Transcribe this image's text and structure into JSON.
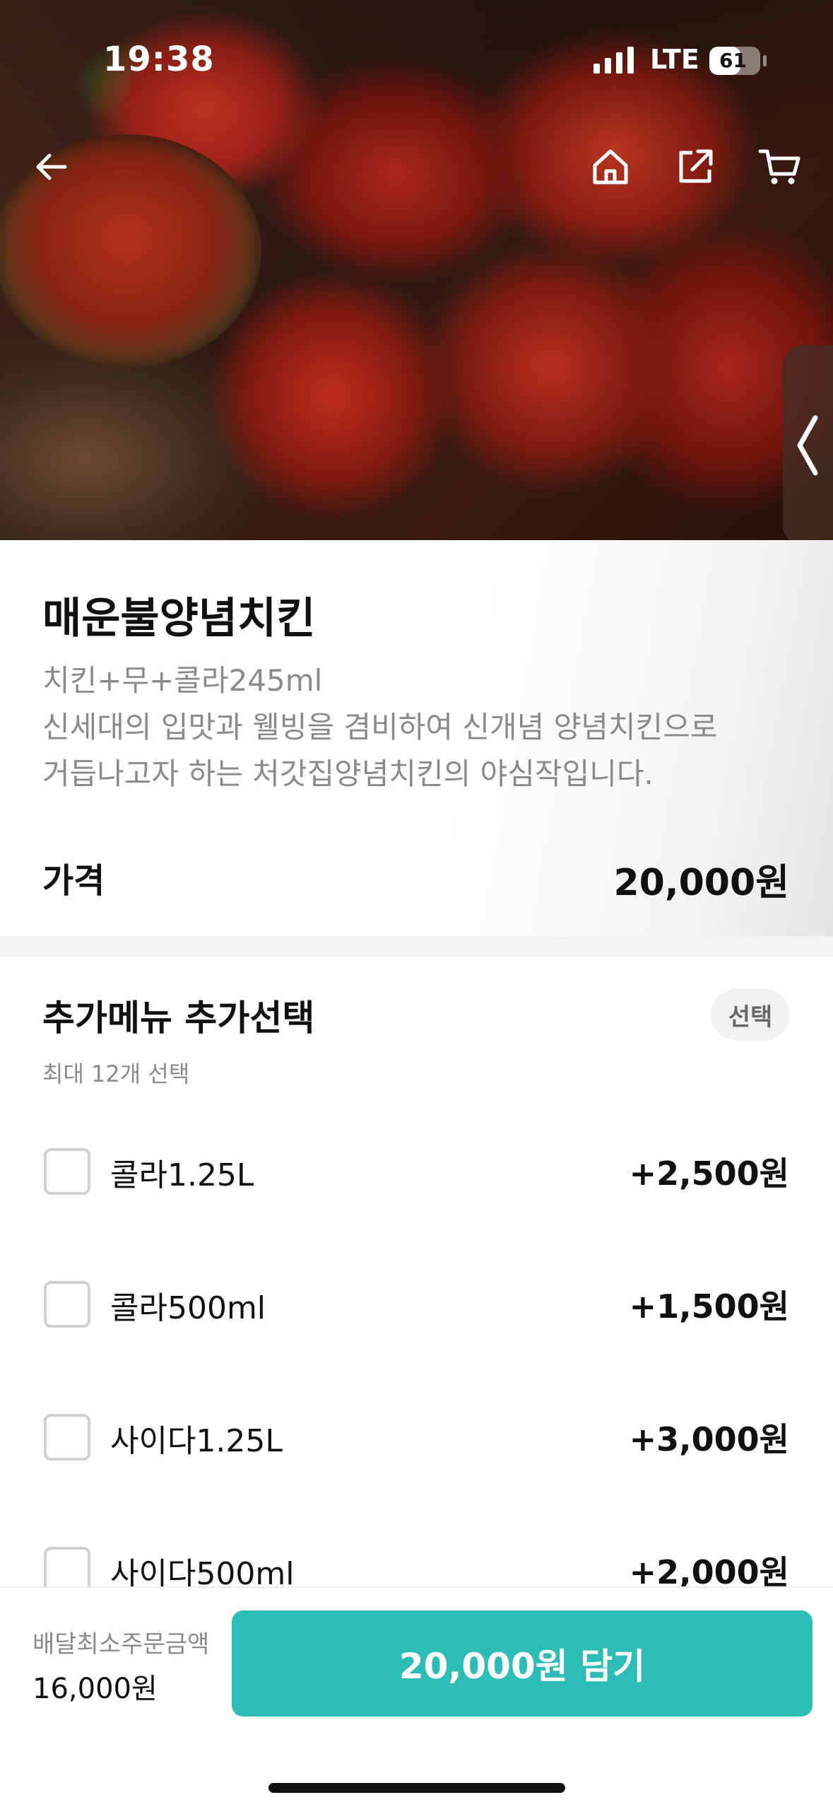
{
  "status_bar": {
    "time": "19:38",
    "network": "LTE",
    "battery": "61",
    "battery_level": 0.61
  },
  "nav": {
    "back_icon": "arrow-left-icon",
    "home_icon": "home-icon",
    "share_icon": "share-icon",
    "cart_icon": "cart-icon"
  },
  "product": {
    "name": "매운불양념치킨",
    "composition": "치킨+무+콜라245ml",
    "description_lines": [
      "신세대의 입맛과 웰빙을 겸비하여 신개념 양념치킨으로",
      "거듭나고자 하는 처갓집양념치킨의 야심작입니다."
    ],
    "price_label": "가격",
    "price": "20,000원"
  },
  "options": {
    "title": "추가메뉴 추가선택",
    "badge": "선택",
    "subtitle": "최대 12개 선택",
    "items": [
      {
        "name": "콜라1.25L",
        "price": "+2,500원"
      },
      {
        "name": "콜라500ml",
        "price": "+1,500원"
      },
      {
        "name": "사이다1.25L",
        "price": "+3,000원"
      },
      {
        "name": "사이다500ml",
        "price": "+2,000원"
      }
    ]
  },
  "bottom": {
    "min_order_label": "배달최소주문금액",
    "min_order_value": "16,000원",
    "add_button": "20,000원 담기"
  },
  "colors": {
    "accent": "#2bbdb6",
    "text_primary": "#111111",
    "text_secondary": "#8a8a8a",
    "divider": "#f2f3f5"
  }
}
